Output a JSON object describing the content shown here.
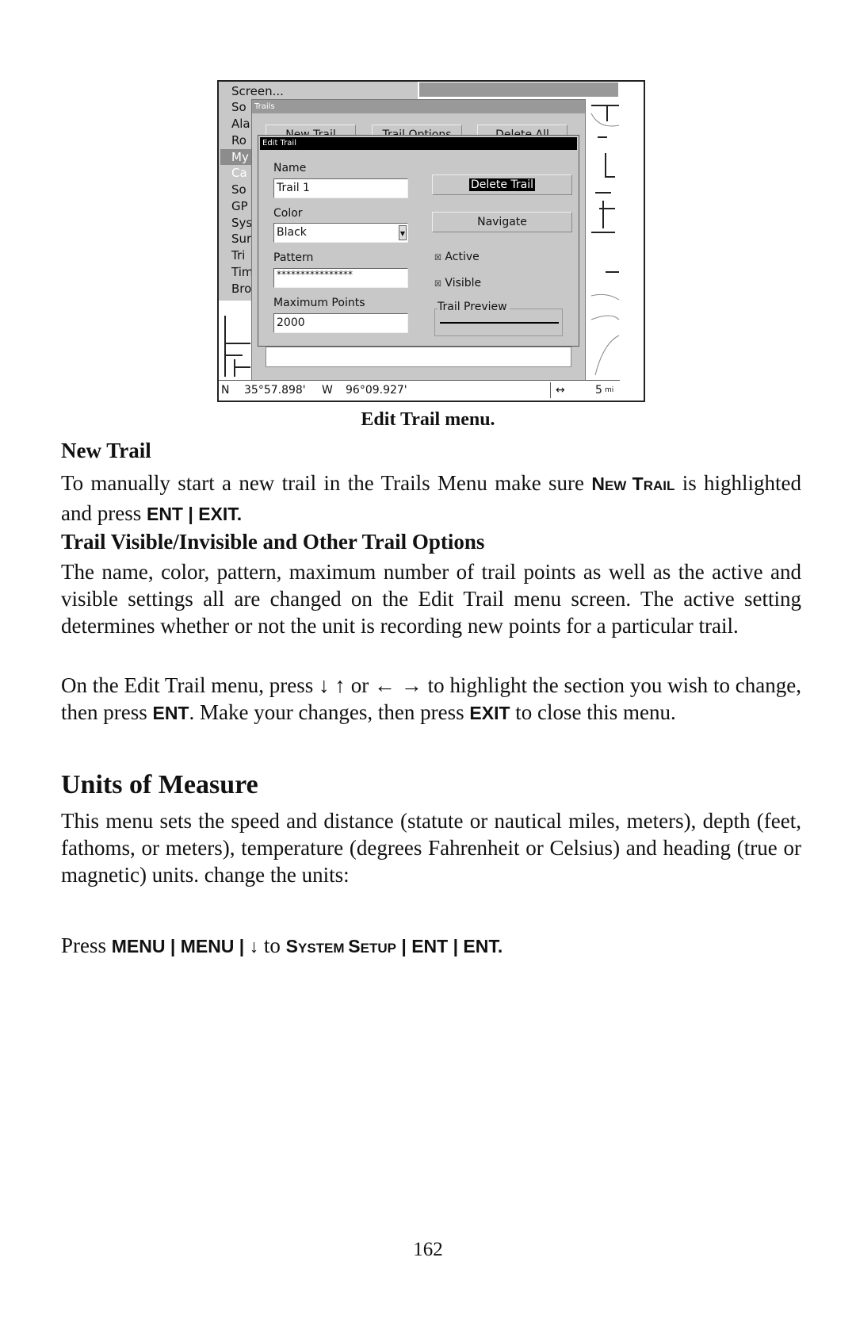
{
  "screenshot": {
    "menu_items": [
      "Screen...",
      "So",
      "Ala",
      "Ro",
      "My",
      "Ca",
      "So",
      "GP",
      "Sys",
      "Sur",
      "Tri",
      "Tim",
      "Bro"
    ],
    "selected_menu_index": 4,
    "disabled_menu_index": 5,
    "trails_dialog": {
      "title": "Trails",
      "buttons": [
        "New Trail",
        "Trail Options",
        "Delete All"
      ]
    },
    "edit_trail": {
      "title": "Edit Trail",
      "name_label": "Name",
      "name_value": "Trail 1",
      "color_label": "Color",
      "color_value": "Black",
      "pattern_label": "Pattern",
      "pattern_value": "****************",
      "max_points_label": "Maximum Points",
      "max_points_value": "2000",
      "delete_button": "Delete Trail",
      "navigate_button": "Navigate",
      "active_label": "Active",
      "active_checked": true,
      "visible_label": "Visible",
      "visible_checked": true,
      "preview_label": "Trail Preview"
    },
    "status": {
      "lat": "N",
      "lat_value": "35°57.898'",
      "lon": "W",
      "lon_value": "96°09.927'",
      "arrow": "↔",
      "scale": "5",
      "scale_unit": "mi"
    }
  },
  "caption": "Edit Trail menu.",
  "sections": {
    "new_trail_heading": "New Trail",
    "new_trail_text_1": "To manually start a new trail in the Trails Menu make sure ",
    "new_trail_key_N": "N",
    "new_trail_key_ew": "EW ",
    "new_trail_key_T": "T",
    "new_trail_key_rail": "RAIL",
    "new_trail_text_2": " is highlighted and press ",
    "new_trail_keys": "ENT | EXIT.",
    "options_heading": "Trail Visible/Invisible and Other Trail Options",
    "options_text": "The name, color, pattern, maximum number of trail points as well as the active and visible settings all are changed on the Edit Trail menu screen. The active setting determines whether or not the unit is recording new points for a particular trail.",
    "nav_text_1": "On the Edit Trail menu, press ↓ ↑ or ← → to highlight the section you wish to change, then press ",
    "nav_key_ent": "ENT",
    "nav_text_2": ". Make your changes, then press ",
    "nav_key_exit": "EXIT",
    "nav_text_3": " to close this menu.",
    "units_heading": "Units of Measure",
    "units_text": "This menu sets the speed and distance (statute or nautical miles, meters), depth (feet, fathoms, or meters), temperature (degrees Fahrenheit or Celsius) and heading (true or magnetic) units. change the units:",
    "press_text": "Press ",
    "press_keys_1": "MENU | MENU | ↓",
    "press_to": " to ",
    "press_S1": "S",
    "press_ystem": "YSTEM ",
    "press_S2": "S",
    "press_etup": "ETUP",
    "press_keys_2": " | ENT | ENT."
  },
  "page_number": "162"
}
